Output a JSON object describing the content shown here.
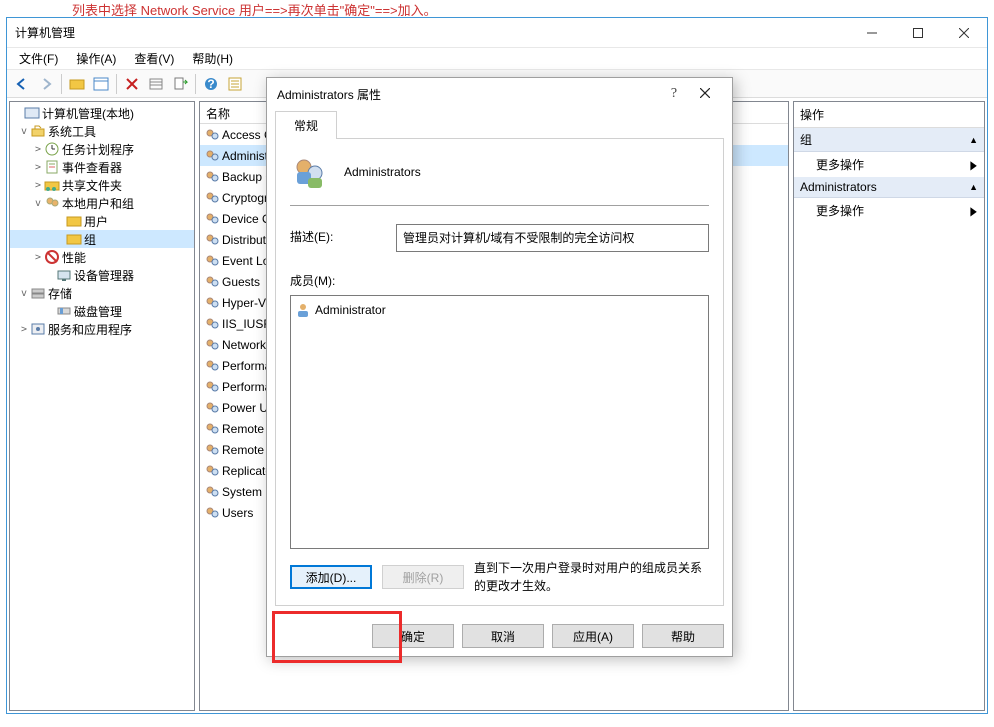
{
  "crop_text": "列表中选择 Network Service 用户==>再次单击\"确定\"==>加入。",
  "window": {
    "title": "计算机管理",
    "menus": [
      "文件(F)",
      "操作(A)",
      "查看(V)",
      "帮助(H)"
    ],
    "controls": {
      "minimize": "—",
      "maximize": "☐",
      "close": "✕"
    }
  },
  "tree": {
    "root": "计算机管理(本地)",
    "system_tools": "系统工具",
    "task_scheduler": "任务计划程序",
    "event_viewer": "事件查看器",
    "shared_folders": "共享文件夹",
    "local_users_groups": "本地用户和组",
    "users_node": "用户",
    "groups_node": "组",
    "performance": "性能",
    "device_manager": "设备管理器",
    "storage": "存储",
    "disk_management": "磁盘管理",
    "services_apps": "服务和应用程序"
  },
  "mid": {
    "header": "名称",
    "items": [
      "Access Control Assistance",
      "Administrators",
      "Backup Operators",
      "Cryptographic Operators",
      "Device Owners",
      "Distributed COM Users",
      "Event Log Readers",
      "Guests",
      "Hyper-V Administrators",
      "IIS_IUSRS",
      "Network Configuration",
      "Performance Log Users",
      "Performance Monitor",
      "Power Users",
      "Remote Desktop Users",
      "Remote Management",
      "Replicator",
      "System Managed",
      "Users"
    ]
  },
  "actions": {
    "title": "操作",
    "section1": "组",
    "more": "更多操作",
    "section2": "Administrators"
  },
  "dialog": {
    "title": "Administrators 属性",
    "tab": "常规",
    "group_name": "Administrators",
    "desc_label": "描述(E):",
    "desc_value": "管理员对计算机/域有不受限制的完全访问权",
    "members_label": "成员(M):",
    "members": [
      "Administrator"
    ],
    "add": "添加(D)...",
    "remove": "删除(R)",
    "note": "直到下一次用户登录时对用户的组成员关系的更改才生效。",
    "ok": "确定",
    "cancel": "取消",
    "apply": "应用(A)",
    "help": "帮助"
  }
}
